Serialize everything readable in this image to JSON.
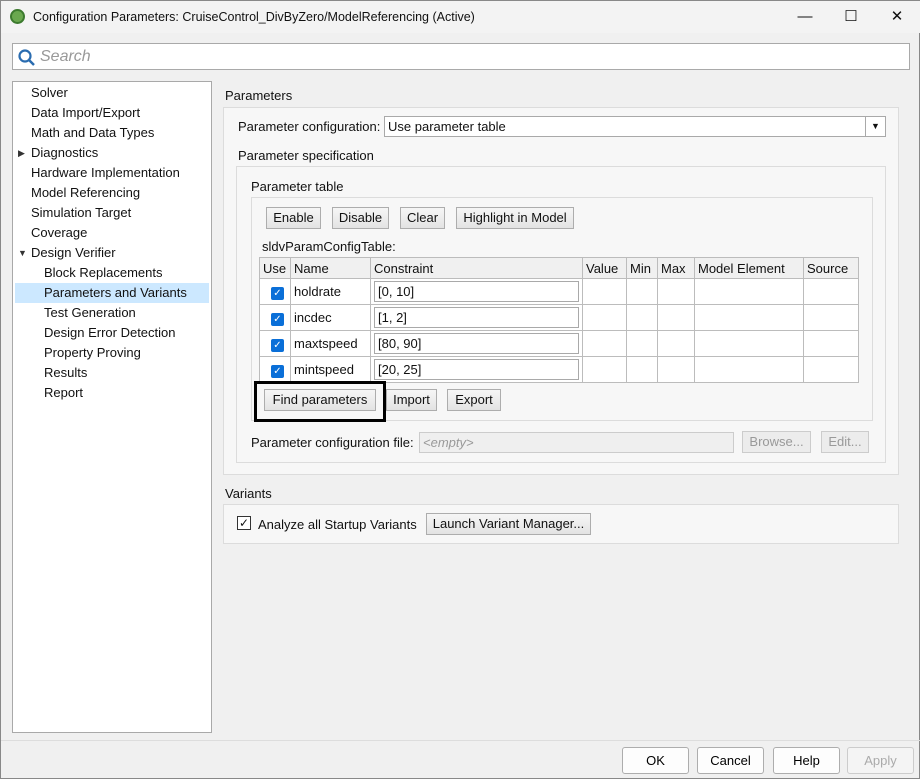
{
  "window": {
    "title": "Configuration Parameters: CruiseControl_DivByZero/ModelReferencing (Active)",
    "minimize": "—",
    "maximize": "☐",
    "close": "✕"
  },
  "search": {
    "placeholder": "Search"
  },
  "tree": [
    {
      "label": "Solver"
    },
    {
      "label": "Data Import/Export"
    },
    {
      "label": "Math and Data Types"
    },
    {
      "label": "Diagnostics"
    },
    {
      "label": "Hardware Implementation"
    },
    {
      "label": "Model Referencing"
    },
    {
      "label": "Simulation Target"
    },
    {
      "label": "Coverage"
    },
    {
      "label": "Design Verifier"
    },
    {
      "label": "Block Replacements"
    },
    {
      "label": "Parameters and Variants"
    },
    {
      "label": "Test Generation"
    },
    {
      "label": "Design Error Detection"
    },
    {
      "label": "Property Proving"
    },
    {
      "label": "Results"
    },
    {
      "label": "Report"
    }
  ],
  "params": {
    "heading": "Parameters",
    "config_label": "Parameter configuration:",
    "config_value": "Use parameter table",
    "spec_label": "Parameter specification",
    "table_label": "Parameter table",
    "buttons": {
      "enable": "Enable",
      "disable": "Disable",
      "clear": "Clear",
      "highlight": "Highlight in Model",
      "find": "Find parameters",
      "import": "Import",
      "export": "Export",
      "browse": "Browse...",
      "edit": "Edit..."
    },
    "table_name": "sldvParamConfigTable:",
    "columns": [
      "Use",
      "Name",
      "Constraint",
      "Value",
      "Min",
      "Max",
      "Model Element",
      "Source"
    ],
    "rows": [
      {
        "name": "holdrate",
        "constraint": "[0, 10]"
      },
      {
        "name": "incdec",
        "constraint": "[1, 2]"
      },
      {
        "name": "maxtspeed",
        "constraint": "[80, 90]"
      },
      {
        "name": "mintspeed",
        "constraint": "[20, 25]"
      }
    ],
    "file_label": "Parameter configuration file:",
    "file_placeholder": "<empty>"
  },
  "variants": {
    "heading": "Variants",
    "checkbox": "Analyze all Startup Variants",
    "launch": "Launch Variant Manager..."
  },
  "footer": {
    "ok": "OK",
    "cancel": "Cancel",
    "help": "Help",
    "apply": "Apply"
  }
}
